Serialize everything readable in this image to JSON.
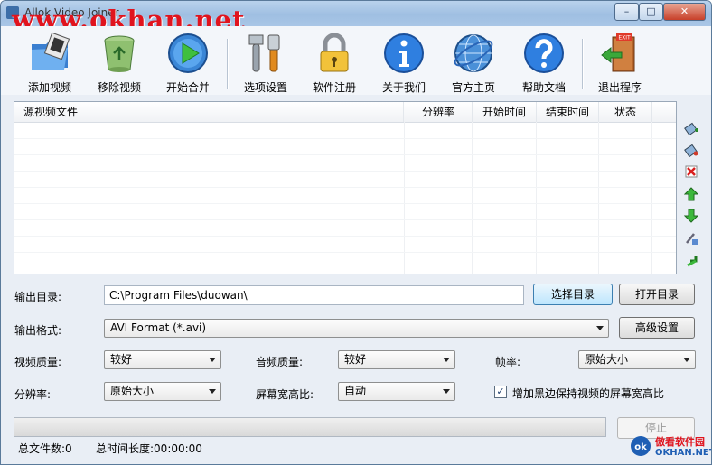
{
  "window": {
    "title": "Allok Video Joiner",
    "watermark": "www.okhan.net",
    "controls": [
      "–",
      "□",
      "✕"
    ]
  },
  "toolbar": [
    {
      "label": "添加视频",
      "icon": "add-video-icon"
    },
    {
      "label": "移除视频",
      "icon": "recycle-bin-icon"
    },
    {
      "label": "开始合并",
      "icon": "play-icon"
    },
    {
      "label": "选项设置",
      "icon": "settings-tools-icon"
    },
    {
      "label": "软件注册",
      "icon": "lock-icon"
    },
    {
      "label": "关于我们",
      "icon": "info-icon"
    },
    {
      "label": "官方主页",
      "icon": "globe-icon"
    },
    {
      "label": "帮助文档",
      "icon": "help-icon"
    },
    {
      "label": "退出程序",
      "icon": "exit-door-icon"
    }
  ],
  "exit_sign": "EXIT",
  "file_list": {
    "columns": [
      "源视频文件",
      "分辨率",
      "开始时间",
      "结束时间",
      "状态"
    ],
    "rows": []
  },
  "side_tools": [
    "add-file-icon",
    "edit-file-icon",
    "delete-file-icon",
    "move-up-icon",
    "move-down-icon",
    "clip-icon",
    "refresh-icon"
  ],
  "output": {
    "dir_label": "输出目录:",
    "dir_value": "C:\\Program Files\\duowan\\",
    "choose_dir": "选择目录",
    "open_dir": "打开目录",
    "format_label": "输出格式:",
    "format_value": "AVI Format (*.avi)",
    "advanced": "高级设置"
  },
  "settings": {
    "video_quality_label": "视频质量:",
    "video_quality": "较好",
    "audio_quality_label": "音频质量:",
    "audio_quality": "较好",
    "framerate_label": "帧率:",
    "framerate": "原始大小",
    "resolution_label": "分辨率:",
    "resolution": "原始大小",
    "aspect_label": "屏幕宽高比:",
    "aspect": "自动",
    "keep_aspect_label": "增加黑边保持视频的屏幕宽高比",
    "keep_aspect_checked": true,
    "check_mark": "✓"
  },
  "progress": {
    "value": 0,
    "stop": "停止"
  },
  "status": {
    "total_files": "总文件数:0",
    "total_duration": "总时间长度:00:00:00"
  },
  "logo": {
    "text_cn": "傲看软件园",
    "text_en": "OKHAN.NET",
    "mark": "ok",
    "colors": {
      "accent": "#e0141e",
      "blue": "#1f5fb4"
    }
  }
}
